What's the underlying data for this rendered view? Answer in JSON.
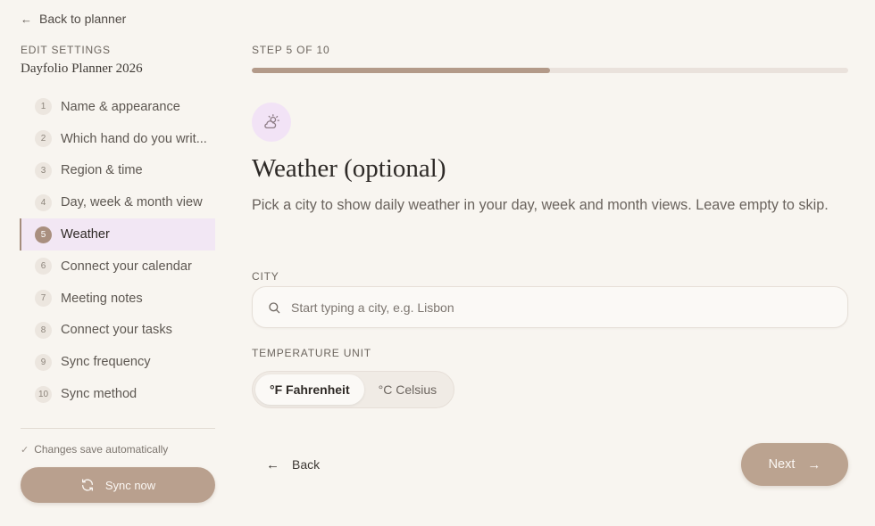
{
  "sidebar": {
    "back_label": "Back to planner",
    "section_label": "EDIT SETTINGS",
    "planner_name": "Dayfolio Planner 2026",
    "steps": [
      {
        "num": "1",
        "label": "Name & appearance"
      },
      {
        "num": "2",
        "label": "Which hand do you writ..."
      },
      {
        "num": "3",
        "label": "Region & time"
      },
      {
        "num": "4",
        "label": "Day, week & month view"
      },
      {
        "num": "5",
        "label": "Weather"
      },
      {
        "num": "6",
        "label": "Connect your calendar"
      },
      {
        "num": "7",
        "label": "Meeting notes"
      },
      {
        "num": "8",
        "label": "Connect your tasks"
      },
      {
        "num": "9",
        "label": "Sync frequency"
      },
      {
        "num": "10",
        "label": "Sync method"
      }
    ],
    "active_step": 5,
    "autosave_text": "Changes save automatically",
    "sync_label": "Sync now"
  },
  "main": {
    "step_text": "STEP 5 OF 10",
    "progress": 0.5,
    "icon": "weather-sun-cloud-icon",
    "title": "Weather (optional)",
    "description": "Pick a city to show daily weather in your day, week and month views. Leave empty to skip.",
    "city": {
      "label": "CITY",
      "placeholder": "Start typing a city, e.g. Lisbon",
      "value": ""
    },
    "temperature": {
      "label": "TEMPERATURE UNIT",
      "options": [
        "°F Fahrenheit",
        "°C Celsius"
      ],
      "selected": "°F Fahrenheit"
    },
    "back_label": "Back",
    "next_label": "Next"
  },
  "colors": {
    "background": "#f8f5f0",
    "accent": "#b9a08e",
    "active_step_bg": "#f2e7f4",
    "icon_badge_bg": "#f2e3f6"
  }
}
